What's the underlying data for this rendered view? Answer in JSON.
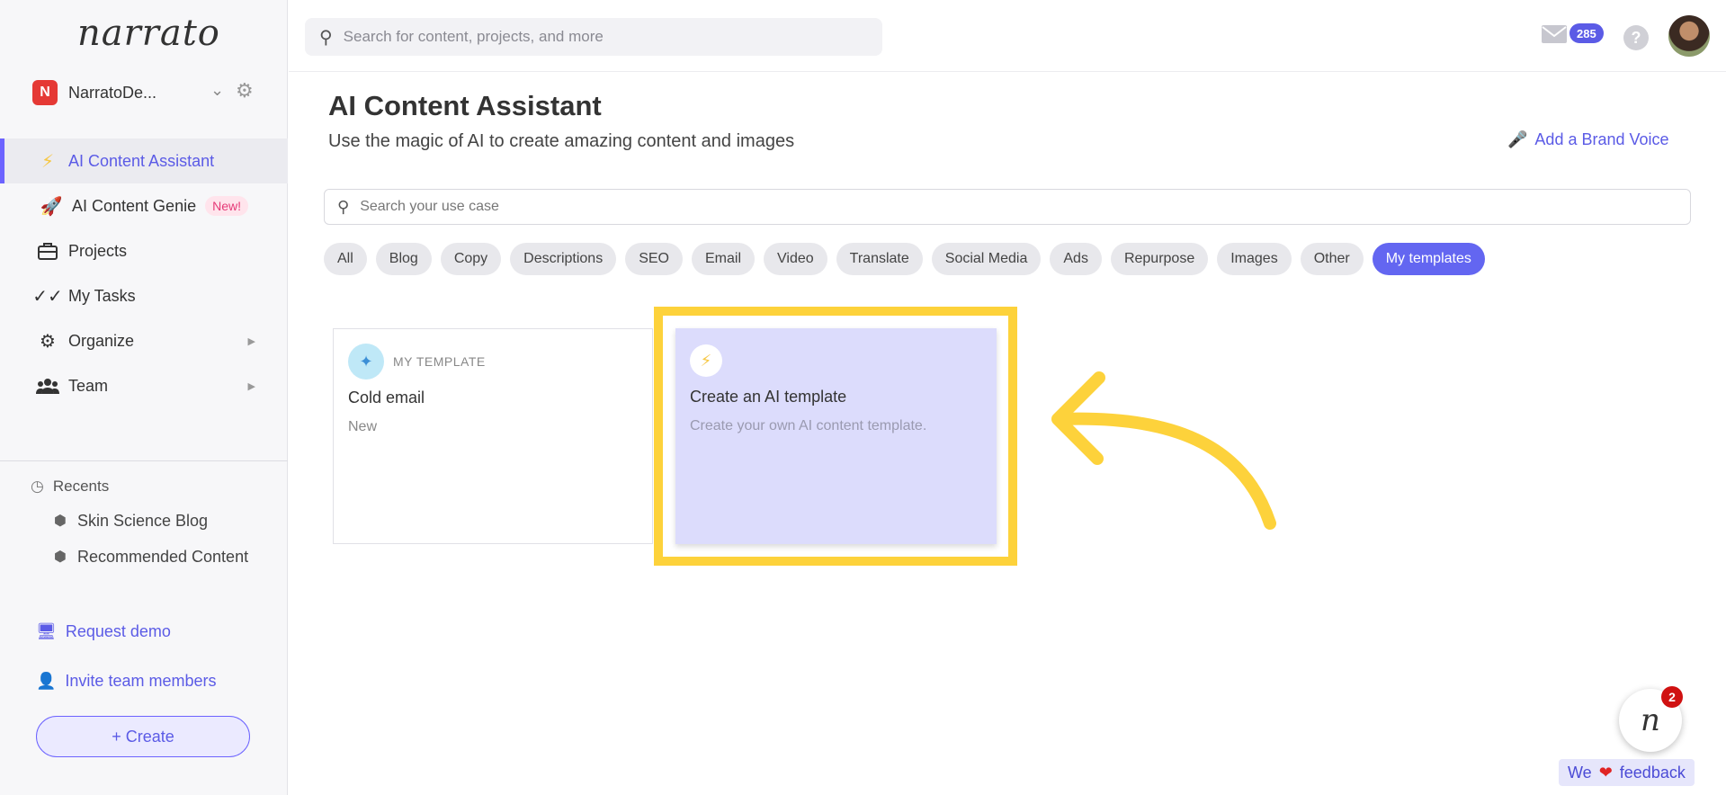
{
  "app": {
    "logo_text": "narrato",
    "workspace": {
      "initial": "N",
      "name": "NarratoDe..."
    }
  },
  "sidebar": {
    "items": [
      {
        "label": "AI Content Assistant",
        "icon": "bolt-icon",
        "active": true
      },
      {
        "label": "AI Content Genie",
        "icon": "rocket-icon",
        "badge": "New!"
      },
      {
        "label": "Projects",
        "icon": "briefcase-icon"
      },
      {
        "label": "My Tasks",
        "icon": "double-check-icon"
      },
      {
        "label": "Organize",
        "icon": "gears-icon",
        "has_submenu": true
      },
      {
        "label": "Team",
        "icon": "team-icon",
        "has_submenu": true
      }
    ],
    "recents_label": "Recents",
    "recents": [
      {
        "label": "Skin Science Blog"
      },
      {
        "label": "Recommended Content"
      }
    ],
    "request_demo": "Request demo",
    "invite_members": "Invite team members",
    "create_label": "+ Create"
  },
  "topbar": {
    "search_placeholder": "Search for content, projects, and more",
    "mail_count": "285",
    "help": "?"
  },
  "main": {
    "title": "AI Content Assistant",
    "subtitle": "Use the magic of AI to create amazing content and images",
    "brand_voice": "Add a Brand Voice",
    "usecase_placeholder": "Search your use case",
    "filters": [
      {
        "label": "All"
      },
      {
        "label": "Blog"
      },
      {
        "label": "Copy"
      },
      {
        "label": "Descriptions"
      },
      {
        "label": "SEO"
      },
      {
        "label": "Email"
      },
      {
        "label": "Video"
      },
      {
        "label": "Translate"
      },
      {
        "label": "Social Media"
      },
      {
        "label": "Ads"
      },
      {
        "label": "Repurpose"
      },
      {
        "label": "Images"
      },
      {
        "label": "Other"
      },
      {
        "label": "My templates",
        "selected": true
      }
    ],
    "cards": [
      {
        "tag": "MY TEMPLATE",
        "title": "Cold email",
        "desc": "New"
      },
      {
        "title": "Create an AI template",
        "desc": "Create your own AI content template."
      }
    ]
  },
  "widgets": {
    "chat_logo": "n",
    "chat_count": "2",
    "feedback_we": "We",
    "feedback_text": "feedback"
  },
  "colors": {
    "accent": "#6366f1",
    "highlight": "#fdd23b",
    "active_link": "#5b5be6"
  }
}
